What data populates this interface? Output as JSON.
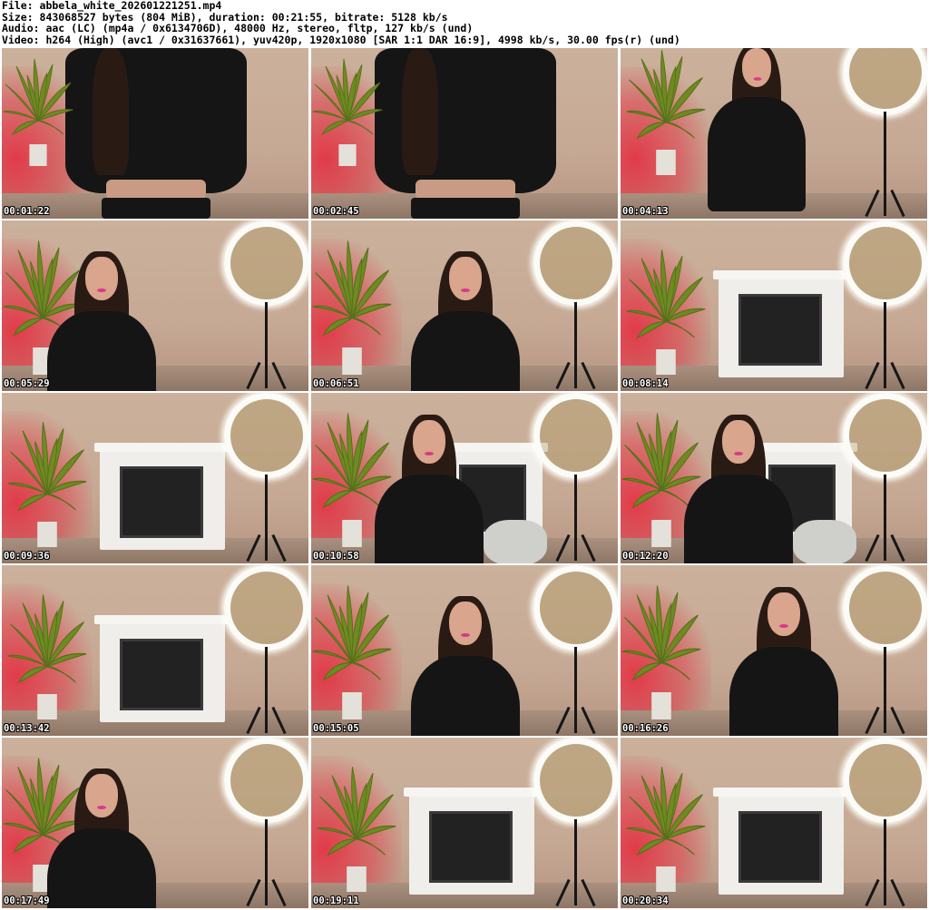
{
  "header": {
    "file_line": "File: abbela_white_202601221251.mp4",
    "size_line": "Size: 843068527 bytes (804 MiB), duration: 00:21:55, bitrate: 5128 kb/s",
    "audio_line": "Audio: aac (LC) (mp4a / 0x6134706D), 48000 Hz, stereo, fltp, 127 kb/s (und)",
    "video_line": "Video: h264 (High) (avc1 / 0x31637661), yuv420p, 1920x1080 [SAR 1:1 DAR 16:9], 4998 kb/s, 30.00 fps(r) (und)"
  },
  "thumbnails": [
    {
      "timestamp": "00:01:22",
      "scene": "torso-close"
    },
    {
      "timestamp": "00:02:45",
      "scene": "torso-close"
    },
    {
      "timestamp": "00:04:13",
      "scene": "standing"
    },
    {
      "timestamp": "00:05:29",
      "scene": "person-left"
    },
    {
      "timestamp": "00:06:51",
      "scene": "person-center"
    },
    {
      "timestamp": "00:08:14",
      "scene": "empty-room"
    },
    {
      "timestamp": "00:09:36",
      "scene": "empty-room"
    },
    {
      "timestamp": "00:10:58",
      "scene": "person-seated"
    },
    {
      "timestamp": "00:12:20",
      "scene": "person-seated"
    },
    {
      "timestamp": "00:13:42",
      "scene": "empty-room"
    },
    {
      "timestamp": "00:15:05",
      "scene": "person-center"
    },
    {
      "timestamp": "00:16:26",
      "scene": "person-right"
    },
    {
      "timestamp": "00:17:49",
      "scene": "person-left"
    },
    {
      "timestamp": "00:19:11",
      "scene": "empty-room"
    },
    {
      "timestamp": "00:20:34",
      "scene": "empty-room"
    }
  ],
  "colors": {
    "background": "#ffffff",
    "wall": "#c6a994",
    "red_light": "#e6283c",
    "plant": "#6f8a22",
    "clothing": "#151515",
    "lips": "#d83a8a"
  }
}
